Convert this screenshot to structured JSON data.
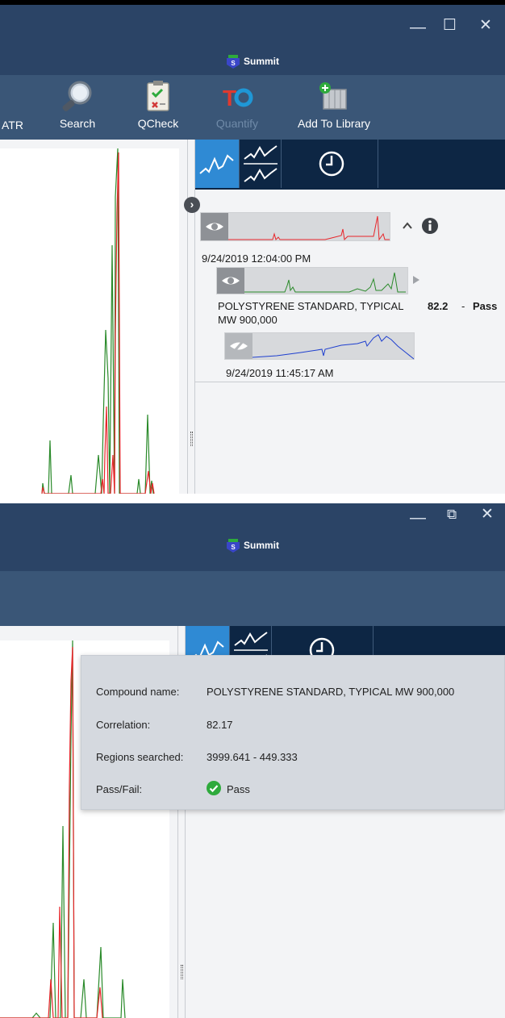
{
  "app": {
    "title": "Summit",
    "minimize_glyph": "—",
    "maximize_glyph": "☐",
    "restore_glyph": "⧉",
    "close_glyph": "✕"
  },
  "ribbon": {
    "atr_label": "ATR",
    "search_label": "Search",
    "qcheck_label": "QCheck",
    "quantify_label": "Quantify",
    "add_library_label": "Add To Library"
  },
  "results": {
    "sample_timestamp": "9/24/2019 12:04:00 PM",
    "match_name_line1": "POLYSTYRENE STANDARD, TYPICAL",
    "match_name_line2": "MW 900,000",
    "match_score": "82.2",
    "match_sep": "-",
    "match_status": "Pass",
    "background_timestamp": "9/24/2019 11:45:17 AM"
  },
  "tooltip": {
    "compound_label": "Compound name:",
    "compound_value": "POLYSTYRENE STANDARD, TYPICAL MW 900,000",
    "correlation_label": "Correlation:",
    "correlation_value": "82.17",
    "regions_label": "Regions searched:",
    "regions_value": "3999.641 - 449.333",
    "passfail_label": "Pass/Fail:",
    "passfail_value": "Pass"
  },
  "colors": {
    "titlebar": "#2b4466",
    "ribbon": "#3a5677",
    "panel_head": "#0d2644",
    "active_tab": "#2f8ad4",
    "sample_spectrum": "#e8252a",
    "library_spectrum": "#2a8a2a",
    "background_spectrum": "#1e3fcf",
    "pass_green": "#2eaa3c"
  },
  "icons": [
    "magnifier-icon",
    "clipboard-check-icon",
    "tq-logo-icon",
    "add-library-icon",
    "spectrum-icon",
    "stacked-spectra-icon",
    "clock-icon",
    "eye-icon",
    "eye-hidden-icon",
    "info-icon",
    "chevron-up-icon",
    "play-arrow-icon",
    "collapse-arrow-icon",
    "check-circle-icon"
  ]
}
